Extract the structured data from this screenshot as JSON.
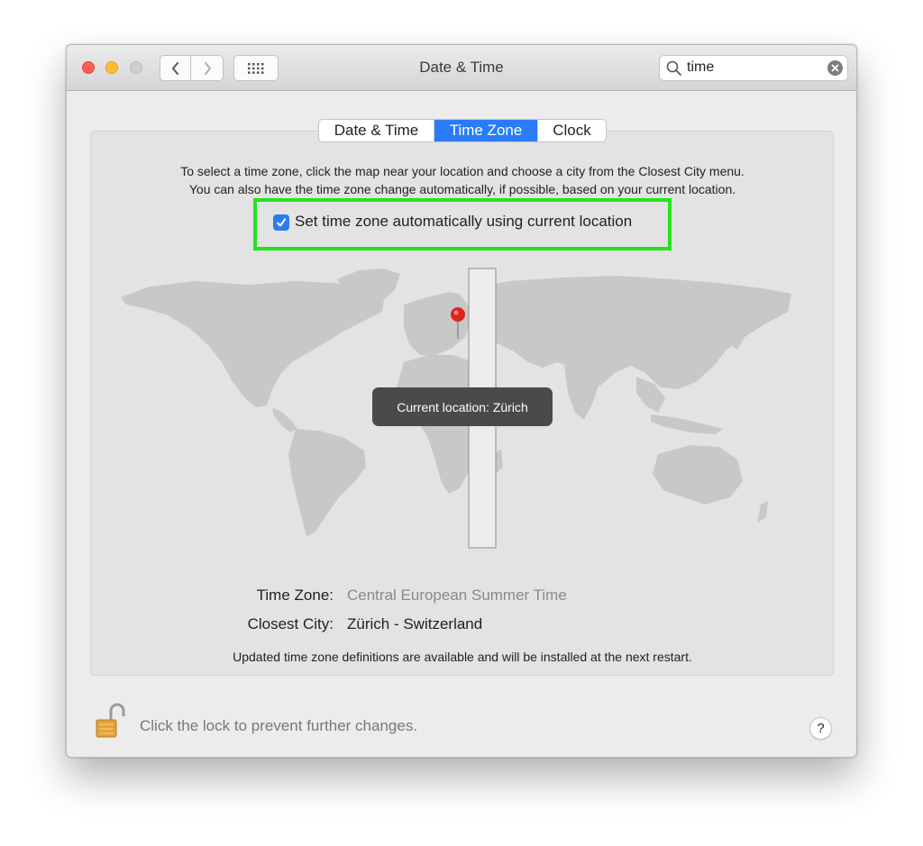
{
  "window": {
    "title": "Date & Time",
    "controls": {
      "close_icon": "close-icon",
      "minimize_icon": "minimize-icon",
      "zoom_icon": "zoom-icon",
      "back_icon": "chevron-left-icon",
      "forward_icon": "chevron-right-icon",
      "grid_icon": "grid-icon"
    }
  },
  "search": {
    "value": "time",
    "search_icon": "magnifier-icon",
    "clear_icon": "clear-icon"
  },
  "tabs": [
    {
      "label": "Date & Time",
      "selected": false
    },
    {
      "label": "Time Zone",
      "selected": true
    },
    {
      "label": "Clock",
      "selected": false
    }
  ],
  "time_zone_pane": {
    "instructions": [
      "To select a time zone, click the map near your location and choose a city from the Closest City menu.",
      "You can also have the time zone change automatically, if possible, based on your current location."
    ],
    "auto_checkbox": {
      "label": "Set time zone automatically using current location",
      "checked": true
    },
    "map": {
      "tooltip": "Current location: Zürich",
      "pin_icon": "map-pin-icon"
    },
    "time_zone_label": "Time Zone:",
    "time_zone_value": "Central European Summer Time",
    "closest_city_label": "Closest City:",
    "closest_city_value": "Zürich - Switzerland",
    "update_notice": "Updated time zone definitions are available and will be installed at the next restart."
  },
  "footer": {
    "lock_icon": "unlocked-padlock-icon",
    "lock_text": "Click the lock to prevent further changes.",
    "help_label": "?"
  },
  "colors": {
    "accent": "#2a7cf6",
    "highlight": "#22e51a",
    "land": "#c8c8c8",
    "selected_zone": "#eeeeee"
  }
}
